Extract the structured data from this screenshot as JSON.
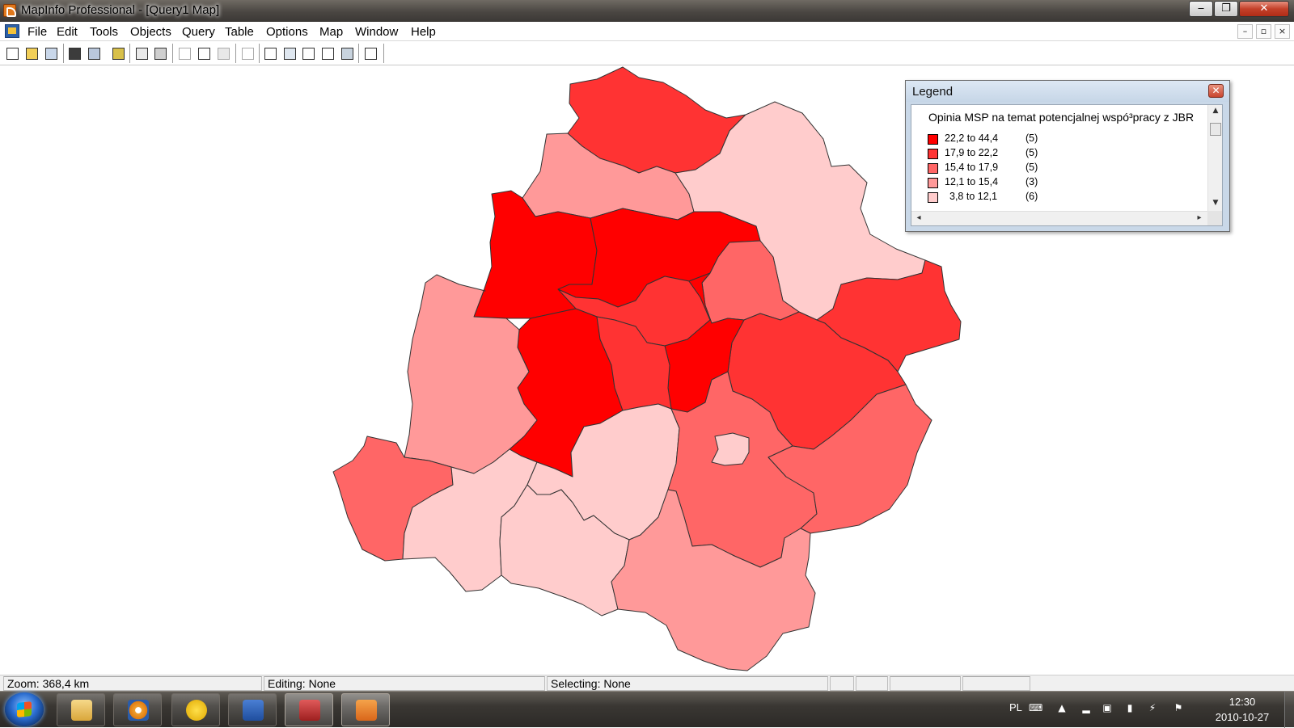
{
  "window": {
    "title": "MapInfo Professional - [Query1 Map]",
    "minimize_glyph": "‒",
    "maximize_glyph": "❐",
    "close_glyph": "✕"
  },
  "menu": {
    "items": [
      "File",
      "Edit",
      "Tools",
      "Objects",
      "Query",
      "Table",
      "Options",
      "Map",
      "Window",
      "Help"
    ],
    "mdi_minimize": "–",
    "mdi_restore": "▫",
    "mdi_close": "×"
  },
  "toolbar": {
    "buttons": [
      "new-table",
      "open-table",
      "open-workspace",
      "save-table",
      "save-workspace",
      "import",
      "print-preview",
      "print",
      "cut",
      "copy",
      "paste",
      "undo",
      "new-browser",
      "new-mapper",
      "new-grapher",
      "new-layout",
      "new-redistrict",
      "help"
    ]
  },
  "legend": {
    "window_title": "Legend",
    "close_glyph": "✕",
    "heading": "Opinia MSP na temat potencjalnej wspó³pracy z JBR",
    "rows": [
      {
        "range": "22,2 to 44,4",
        "count": "(5)",
        "color": "#ff0000"
      },
      {
        "range": "17,9 to 22,2",
        "count": "(5)",
        "color": "#ff3333"
      },
      {
        "range": "15,4 to 17,9",
        "count": "(5)",
        "color": "#ff6666"
      },
      {
        "range": "12,1 to 15,4",
        "count": "(3)",
        "color": "#ff9999"
      },
      {
        "range": "3,8 to 12,1",
        "count": "(6)",
        "color": "#ffcccc"
      }
    ]
  },
  "map": {
    "class_colors": {
      "c1": "#ff0000",
      "c2": "#ff3333",
      "c3": "#ff6666",
      "c4": "#ff9999",
      "c5": "#ffcccc"
    }
  },
  "status": {
    "zoom": "Zoom: 368,4 km",
    "editing": "Editing: None",
    "selecting": "Selecting: None"
  },
  "taskbar": {
    "apps": [
      "file-explorer",
      "media-player",
      "sync-app",
      "word",
      "statistics-app",
      "mapinfo"
    ],
    "language": "PL",
    "time": "12:30",
    "date": "2010-10-27"
  }
}
